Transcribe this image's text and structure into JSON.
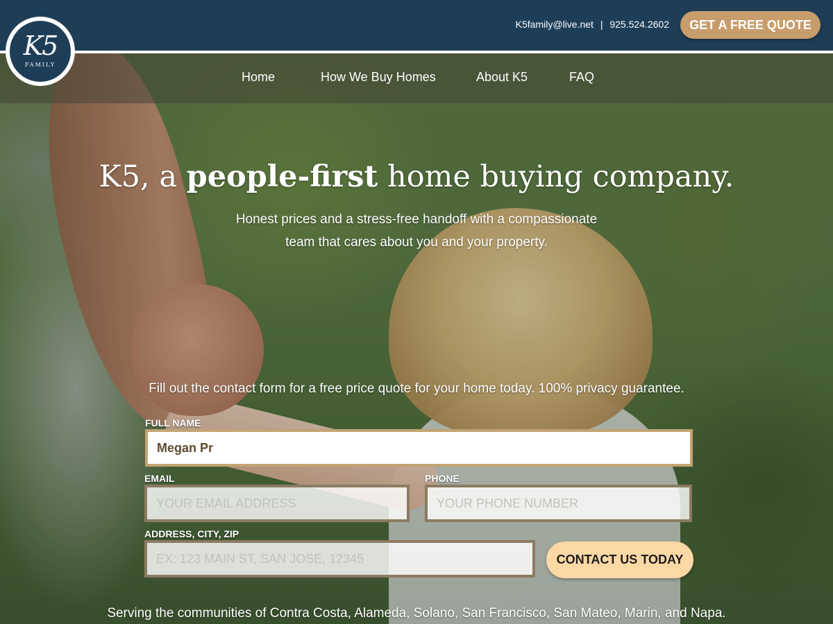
{
  "brand": {
    "logo_text": "K5",
    "logo_subtext": "FAMILY"
  },
  "header": {
    "email": "K5family@live.net",
    "separator": "|",
    "phone": "925.524.2602",
    "quote_button": "GET A FREE QUOTE"
  },
  "nav": {
    "items": [
      {
        "label": "Home"
      },
      {
        "label": "How We Buy Homes"
      },
      {
        "label": "About K5"
      },
      {
        "label": "FAQ"
      }
    ]
  },
  "hero": {
    "title_prefix": "K5, a ",
    "title_bold": "people-first",
    "title_suffix": " home buying company.",
    "subtitle_line1": "Honest prices and a stress-free handoff with a compassionate",
    "subtitle_line2": "team that cares about you and your property."
  },
  "form": {
    "intro": "Fill out the contact form for a free price quote for your home today.  100% privacy guarantee.",
    "full_name": {
      "label": "FULL NAME",
      "value": "Megan Pr"
    },
    "email": {
      "label": "EMAIL",
      "placeholder": "YOUR EMAIL ADDRESS"
    },
    "phone": {
      "label": "PHONE",
      "placeholder": "YOUR PHONE NUMBER"
    },
    "address": {
      "label": "ADDRESS, CITY, ZIP",
      "placeholder": "EX: 123 MAIN ST, SAN JOSE, 12345"
    },
    "submit": "CONTACT US TODAY"
  },
  "footer": {
    "serving": "Serving the communities of Contra Costa, Alameda, Solano, San Francisco, San Mateo, Marin, and Napa."
  },
  "colors": {
    "header_bg": "#1e3e58",
    "quote_button": "#c89d6c",
    "submit_button": "#fcd8a5",
    "field_border": "#8b7b61",
    "active_field_border": "#c3a472"
  }
}
